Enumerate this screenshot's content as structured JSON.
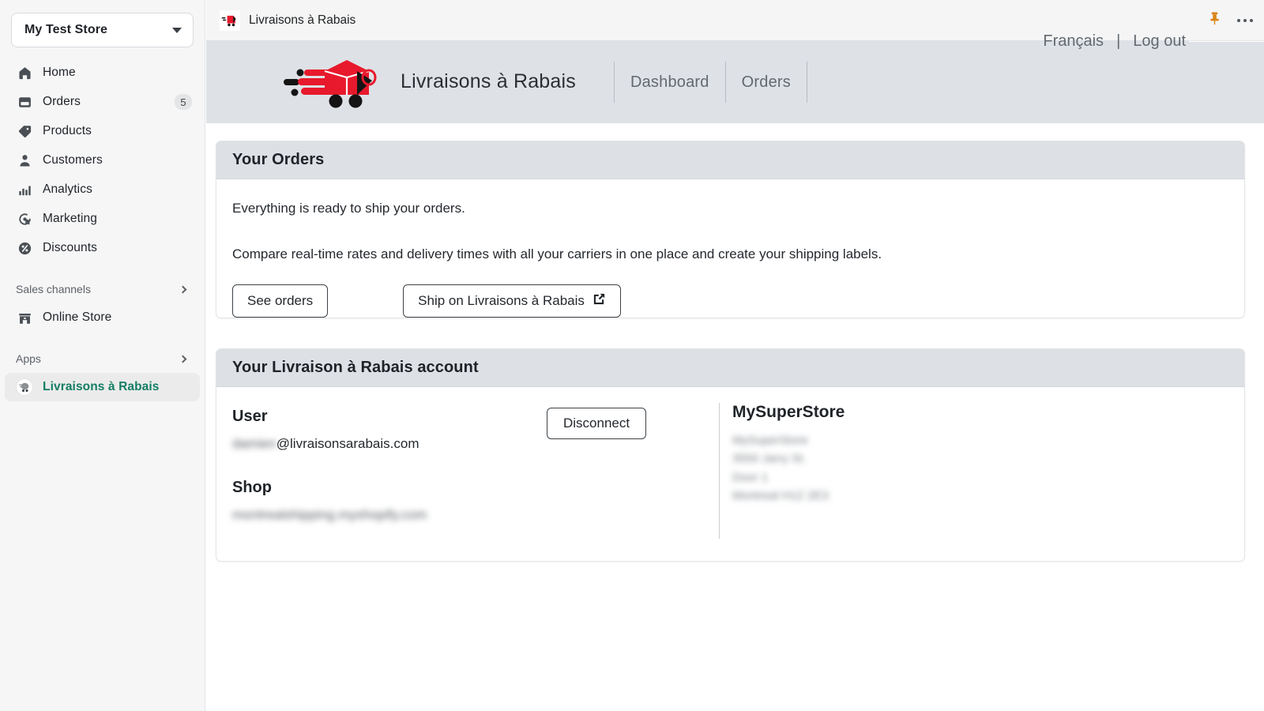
{
  "sidebar": {
    "store_switcher": {
      "name": "My Test Store",
      "icon": "chevron-down-icon"
    },
    "items": [
      {
        "label": "Home",
        "icon": "home-icon",
        "badge": ""
      },
      {
        "label": "Orders",
        "icon": "orders-icon",
        "badge": "5"
      },
      {
        "label": "Products",
        "icon": "products-tag-icon",
        "badge": ""
      },
      {
        "label": "Customers",
        "icon": "customers-person-icon",
        "badge": ""
      },
      {
        "label": "Analytics",
        "icon": "analytics-bars-icon",
        "badge": ""
      },
      {
        "label": "Marketing",
        "icon": "marketing-target-icon",
        "badge": ""
      },
      {
        "label": "Discounts",
        "icon": "discounts-percent-icon",
        "badge": ""
      }
    ],
    "sections": [
      {
        "label": "Sales channels",
        "icon": "chevron-right-icon"
      },
      {
        "label": "Apps",
        "icon": "chevron-right-icon"
      }
    ],
    "online_store": {
      "label": "Online Store",
      "icon": "storefront-icon"
    },
    "active_app": {
      "label": "Livraisons à Rabais",
      "icon": "app-avatar-icon"
    }
  },
  "titlebar": {
    "title": "Livraisons à Rabais",
    "favicon": "livraisons-a-rabais-favicon",
    "pin_icon": "pin-icon",
    "more_icon": "more-options-icon"
  },
  "app_header": {
    "logo": "livraisons-a-rabais-logo",
    "brand": "Livraisons à Rabais",
    "nav": [
      {
        "label": "Dashboard"
      },
      {
        "label": "Orders"
      }
    ],
    "language": "Français",
    "separator": "|",
    "logout": "Log out"
  },
  "orders_card": {
    "title": "Your Orders",
    "line1": "Everything is ready to ship your orders.",
    "line2": "Compare real-time rates and delivery times with all your carriers in one place and create your shipping labels.",
    "see_orders_label": "See orders",
    "ship_label": "Ship on Livraisons à Rabais",
    "ship_icon": "external-link-icon"
  },
  "account_card": {
    "title": "Your Livraison à Rabais account",
    "user_heading": "User",
    "user_email_masked": "damien",
    "user_email_domain": "@livraisonsarabais.com",
    "shop_heading": "Shop",
    "shop_value_masked": "montrealshipping.myshopify.com",
    "disconnect_label": "Disconnect",
    "store_name": "MySuperStore",
    "address": [
      "MySuperStore",
      "3550 Jarry St.",
      "Door 1",
      "Montreal H1Z 2E3"
    ]
  },
  "colors": {
    "brand_red": "#e8192c",
    "accent_teal": "#147d64",
    "header_bg": "#dee1e6",
    "sidebar_bg": "#f6f6f7",
    "pin_orange": "#d98516"
  }
}
